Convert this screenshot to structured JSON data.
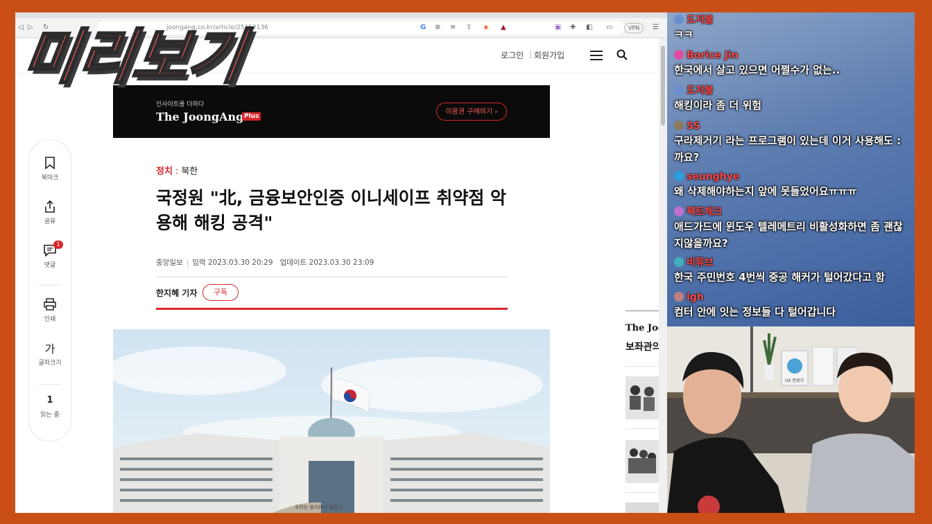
{
  "overlay": {
    "stamp_text": "미리보기"
  },
  "browser": {
    "url": "joongang.co.kr/article/25152136",
    "vpn_label": "VPN"
  },
  "site": {
    "header": {
      "login": "로그인",
      "separator": "|",
      "join": "회원가입"
    },
    "rail": {
      "bookmark_label": "북마크",
      "share_label": "공유",
      "comment_label": "댓글",
      "comment_badge": "1",
      "print_label": "인쇄",
      "fontsize_glyph": "가",
      "fontsize_label": "글자크기",
      "reading_count": "1",
      "reading_label": "읽는 중"
    },
    "banner": {
      "pre": "인사이트를 더하다",
      "logo": "The JoongAng",
      "plus": "Plus",
      "cta": "이용권 구매하기 ›"
    },
    "article": {
      "category": "정치",
      "category_sep": ":",
      "subcategory": "북한",
      "headline": "국정원 \"北, 금융보안인증 이니세이프 취약점 악용해 해킹 공격\"",
      "source": "중앙일보",
      "meta_sep": "|",
      "published": "입력 2023.03.30 20:29",
      "updated": "업데이트 2023.03.30 23:09",
      "reporter": "한지혜 기자",
      "subscribe": "구독",
      "photo_caption_stone": "우리는 음지에서 일하고"
    },
    "sidebar": {
      "title1": "The Joo",
      "title2": "보좌관의"
    }
  },
  "chat": {
    "messages": [
      {
        "name": "도저불",
        "name_color": "#ff4a4a",
        "avatar_color": "#6a8fd0",
        "text": "ㅋㅋ"
      },
      {
        "name": "Borice Jin",
        "name_color": "#ff4a4a",
        "avatar_color": "#e04aa0",
        "text": "한국에서 살고 있으면 어쩔수가 없는.."
      },
      {
        "name": "도저불",
        "name_color": "#ff4a4a",
        "avatar_color": "#6a8fd0",
        "text": "해킹이라 좀 더 위험"
      },
      {
        "name": "SS",
        "name_color": "#ff4a4a",
        "avatar_color": "#8c7a5a",
        "text": "구라제거기 라는 프로그램이 있는데 이거 사용해도 :",
        "text2": "까요?"
      },
      {
        "name": "seunghye",
        "name_color": "#ff4a4a",
        "avatar_color": "#2aa0e0",
        "text": "왜 삭제해야하는지 앞에 못들었어요ㅠㅠㅠ"
      },
      {
        "name": "팩트체크",
        "name_color": "#ff4a4a",
        "avatar_color": "#c070d0",
        "text": "애드가드에 윈도우 텔레메트리 비활성화하면 좀 괜찮",
        "text2": "지않을까요?"
      },
      {
        "name": "비튜브",
        "name_color": "#ff4a4a",
        "avatar_color": "#40b0c0",
        "text": "한국 주민번호 4번씩 중공 해커가 털어갔다고 함"
      },
      {
        "name": "lgh",
        "name_color": "#ff4a4a",
        "avatar_color": "#c08080",
        "text": "컴터 안에 잇는 정보들 다 털어갑니다"
      }
    ]
  },
  "webcam": {
    "book_label": "UX 전성기"
  },
  "colors": {
    "frame": "#c94f17",
    "accent_red": "#d9262b",
    "chat_name": "#ff4a4a"
  }
}
